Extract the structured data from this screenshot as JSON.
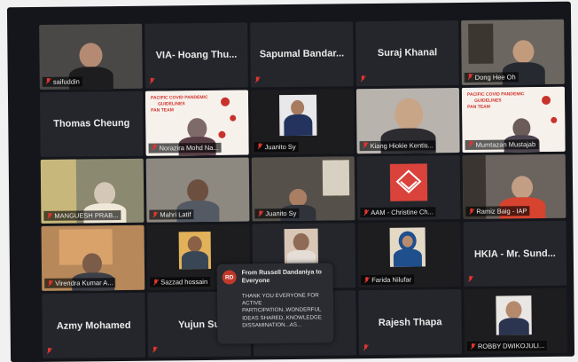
{
  "tiles": [
    {
      "id": "t1",
      "label": "saifuddin",
      "video": true
    },
    {
      "id": "t2",
      "big": "VIA- Hoang Thu..."
    },
    {
      "id": "t3",
      "big": "Sapumal  Bandar..."
    },
    {
      "id": "t4",
      "big": "Suraj Khanal"
    },
    {
      "id": "t5",
      "label": "Dong Hee Oh",
      "video": true
    },
    {
      "id": "t6",
      "big": "Thomas Cheung"
    },
    {
      "id": "t7",
      "label": "Norazira Mohd Na...",
      "video": true
    },
    {
      "id": "t8",
      "label": "Juanito Sy",
      "video": true
    },
    {
      "id": "t9",
      "label": "Kiang Hiokie Kentis...",
      "video": true
    },
    {
      "id": "t10",
      "label": "Mumtazan Mustajab",
      "video": true
    },
    {
      "id": "t11",
      "label": "MANGUESH PRAB...",
      "video": true
    },
    {
      "id": "t12",
      "label": "Mahri Latif",
      "video": true
    },
    {
      "id": "t13",
      "label": "Juanito Sy",
      "video": true
    },
    {
      "id": "t14",
      "label": "AAM - Christine Ch...",
      "video": true
    },
    {
      "id": "t15",
      "label": "Ramiz Baig - IAP",
      "video": true
    },
    {
      "id": "t16",
      "label": "Virendra Kumar A...",
      "video": true
    },
    {
      "id": "t17",
      "label": "Sazzad hossain",
      "video": true
    },
    {
      "id": "t18",
      "label": "",
      "video": true
    },
    {
      "id": "t19",
      "label": "Farida Nilufar",
      "video": true
    },
    {
      "id": "t20",
      "big": "HKIA - Mr. Sund..."
    },
    {
      "id": "t21",
      "big": "Azmy Mohamed"
    },
    {
      "id": "t22",
      "big": "Yujun Su"
    },
    {
      "id": "t23",
      "big": ""
    },
    {
      "id": "t24",
      "big": "Rajesh Thapa"
    },
    {
      "id": "t25",
      "label": "ROBBY DWIKOJULI...",
      "video": true
    }
  ],
  "slide": {
    "line1": "PACIFIC COVID PANDEMIC",
    "line2": "GUIDELINES",
    "line3": "PAN TEAM"
  },
  "chat": {
    "initials": "RD",
    "from": "From Russell Dandaniya to Everyone",
    "message": "THANK YOU EVERYONE FOR ACTIVE PARTICIPATION..WONDERFUL IDEAS SHARED, KNOWLEDGE DISSAMINATION...AS..."
  },
  "colors": {
    "mute": "#e3342f",
    "tile": "#24262c",
    "slide_accent": "#d1342d"
  }
}
